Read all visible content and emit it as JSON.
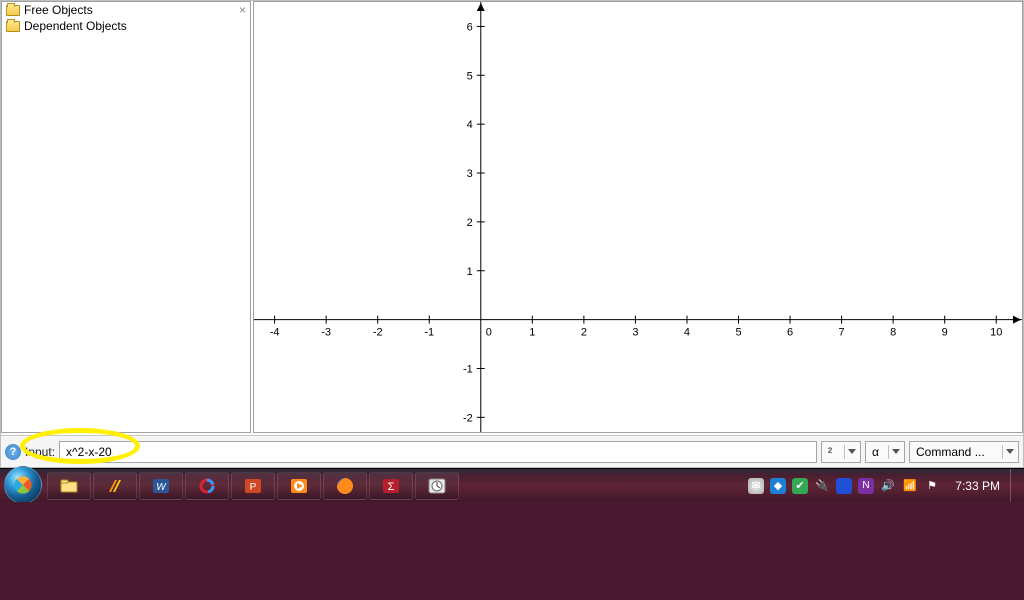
{
  "sidebar": {
    "items": [
      {
        "label": "Free Objects"
      },
      {
        "label": "Dependent Objects"
      }
    ],
    "close_icon": "×"
  },
  "input_bar": {
    "help_glyph": "?",
    "label": "Input:",
    "value": "x^2-x-20",
    "dropdown_power": "²",
    "dropdown_greek": "α",
    "dropdown_command": "Command ..."
  },
  "taskbar": {
    "clock": "7:33 PM",
    "apps": [
      "file-explorer",
      "winamp",
      "ms-word",
      "app-red-circle",
      "powerpoint",
      "media-player",
      "firefox",
      "sigma",
      "clock-app"
    ],
    "tray": [
      "messages",
      "security",
      "update",
      "power",
      "network",
      "onenote",
      "volume",
      "wifi",
      "flag"
    ]
  },
  "chart_data": {
    "type": "line",
    "series": [],
    "title": "",
    "xlabel": "",
    "ylabel": "",
    "x_ticks": [
      -4,
      -3,
      -2,
      -1,
      0,
      1,
      2,
      3,
      4,
      5,
      6,
      7,
      8,
      9,
      10
    ],
    "y_ticks": [
      -2,
      -1,
      1,
      2,
      3,
      4,
      5,
      6
    ],
    "xlim": [
      -4.4,
      10.5
    ],
    "ylim": [
      -2.3,
      6.5
    ],
    "origin_label": "0"
  }
}
